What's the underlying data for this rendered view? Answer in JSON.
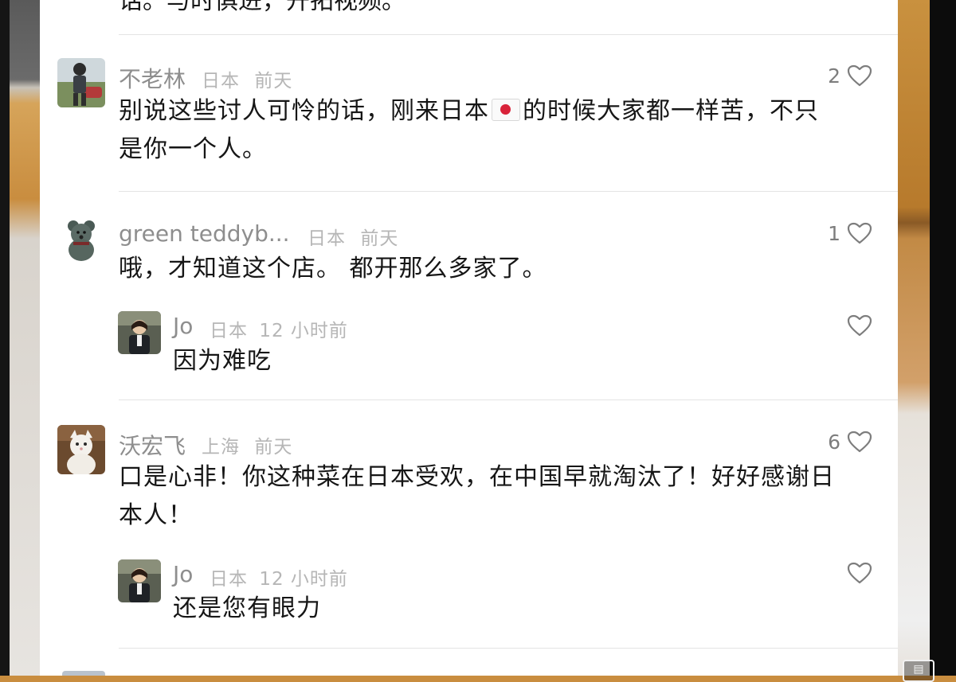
{
  "previous_comment": {
    "text_fragment": "话。与时俱进，开拓视频。"
  },
  "comments": [
    {
      "username": "不老林",
      "location": "日本",
      "time": "前天",
      "text_before_flag": "别说这些讨人可怜的话，刚来日本",
      "flag_icon": "japan-flag-icon",
      "text_after_flag_line1": "的时候大家都一样苦，不只",
      "text_line2": "是你一个人。",
      "likes": "2",
      "avatar_icon": "motorcycle-rider-avatar"
    },
    {
      "username": "green teddyb...",
      "location": "日本",
      "time": "前天",
      "text": "哦，才知道这个店。 都开那么多家了。",
      "likes": "1",
      "avatar_icon": "teddy-bear-avatar",
      "reply": {
        "username": "Jo",
        "location": "日本",
        "time": "12 小时前",
        "text": "因为难吃",
        "avatar_icon": "person-avatar"
      }
    },
    {
      "username": "沃宏飞",
      "location": "上海",
      "time": "前天",
      "text_line1": "口是心非！你这种菜在日本受欢，在中国早就淘汰了！好好感谢日",
      "text_line2": "本人！",
      "likes": "6",
      "avatar_icon": "white-cat-avatar",
      "reply": {
        "username": "Jo",
        "location": "日本",
        "time": "12 小时前",
        "text": "还是您有眼力",
        "avatar_icon": "person-avatar"
      }
    }
  ],
  "colors": {
    "username": "#8e8e8e",
    "meta": "#b6b6b6",
    "body_text": "#161616",
    "divider": "#e4e4e4"
  }
}
